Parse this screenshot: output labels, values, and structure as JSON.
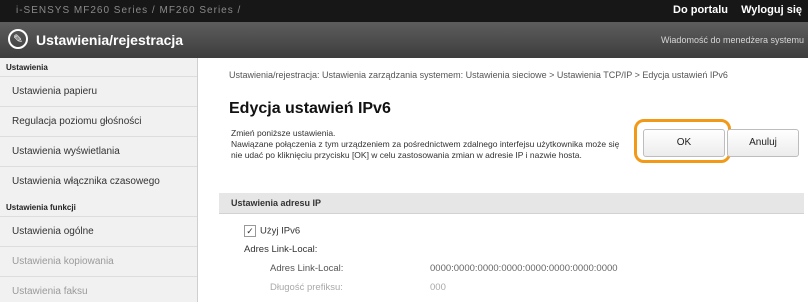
{
  "topbar": {
    "device": "i-SENSYS   MF260 Series / MF260 Series /",
    "portal_link": "Do portalu",
    "logout_link": "Wyloguj się"
  },
  "titlebar": {
    "title": "Ustawienia/rejestracja",
    "message": "Wiadomość do menedżera systemu"
  },
  "sidebar": {
    "header1": "Ustawienia",
    "items1": [
      "Ustawienia papieru",
      "Regulacja poziomu głośności",
      "Ustawienia wyświetlania",
      "Ustawienia włącznika czasowego"
    ],
    "header2": "Ustawienia funkcji",
    "items2": [
      "Ustawienia ogólne",
      "Ustawienia kopiowania",
      "Ustawienia faksu"
    ]
  },
  "main": {
    "breadcrumb": "Ustawienia/rejestracja: Ustawienia zarządzania systemem: Ustawienia sieciowe > Ustawienia TCP/IP > Edycja ustawień IPv6",
    "title": "Edycja ustawień IPv6",
    "desc_line1": "Zmień poniższe ustawienia.",
    "desc_line2": "Nawiązane połączenia z tym urządzeniem za pośrednictwem zdalnego interfejsu użytkownika może się nie udać po kliknięciu przycisku [OK] w celu zastosowania zmian w adresie IP i nazwie hosta.",
    "ok_label": "OK",
    "cancel_label": "Anuluj",
    "section_title": "Ustawienia adresu IP",
    "use_ipv6_label": "Użyj IPv6",
    "use_ipv6_checked": "✓",
    "link_local_heading": "Adres Link-Local:",
    "rows": [
      {
        "label": "Adres Link-Local:",
        "value": "0000:0000:0000:0000:0000:0000:0000:0000"
      },
      {
        "label": "Długość prefiksu:",
        "value": "000"
      }
    ]
  }
}
